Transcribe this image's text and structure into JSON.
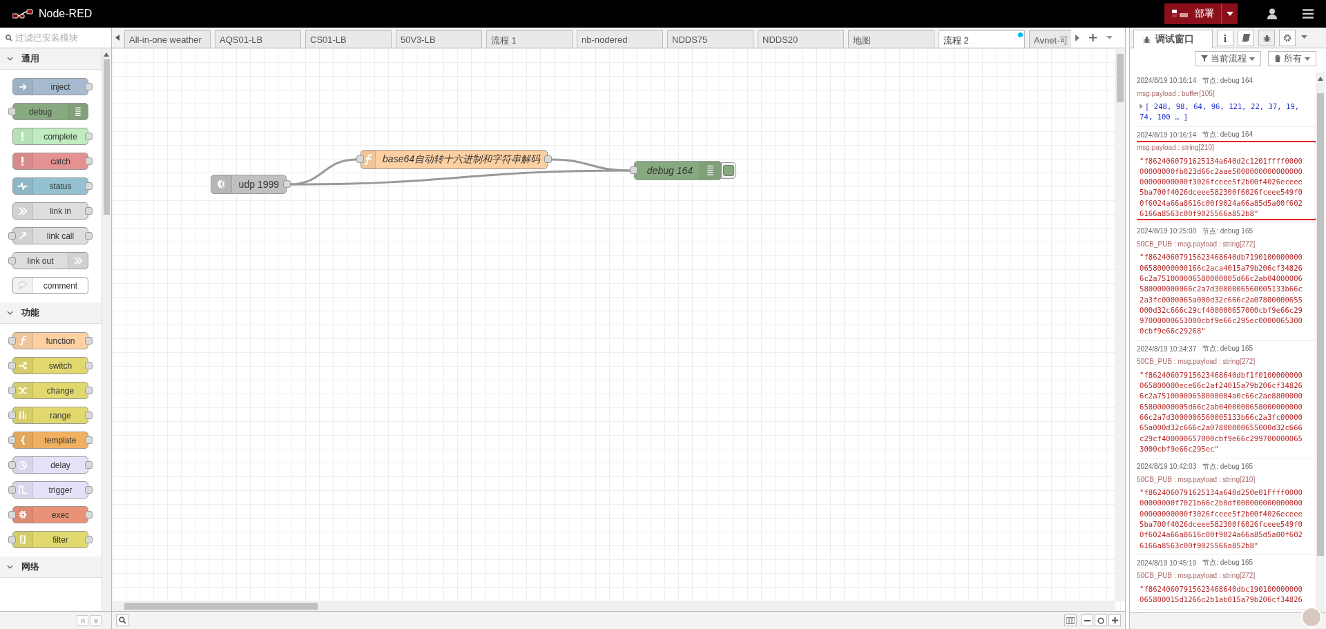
{
  "header": {
    "title": "Node-RED",
    "deploy": {
      "label": "部署"
    }
  },
  "palette": {
    "search": {
      "placeholder": "过滤已安装模块"
    },
    "categories": [
      {
        "label": "通用",
        "expanded": true,
        "nodes": [
          {
            "label": "inject",
            "color": "#a6bbcf",
            "input": false,
            "output": true,
            "icon_right": false
          },
          {
            "label": "debug",
            "color": "#87a980",
            "input": true,
            "output": false,
            "icon_right": true
          },
          {
            "label": "complete",
            "color": "#c0edc0",
            "input": false,
            "output": true,
            "icon_right": false
          },
          {
            "label": "catch",
            "color": "#e49191",
            "input": false,
            "output": true,
            "icon_right": false
          },
          {
            "label": "status",
            "color": "#94c1d0",
            "input": false,
            "output": true,
            "icon_right": false
          },
          {
            "label": "link in",
            "color": "#dddddd",
            "input": false,
            "output": true,
            "icon_right": false
          },
          {
            "label": "link call",
            "color": "#dddddd",
            "input": true,
            "output": true,
            "icon_right": false
          },
          {
            "label": "link out",
            "color": "#dddddd",
            "input": true,
            "output": false,
            "icon_right": true
          },
          {
            "label": "comment",
            "color": "#ffffff",
            "input": false,
            "output": false,
            "icon_right": false
          }
        ]
      },
      {
        "label": "功能",
        "expanded": true,
        "nodes": [
          {
            "label": "function",
            "color": "#fdd0a2",
            "input": true,
            "output": true,
            "icon_right": false
          },
          {
            "label": "switch",
            "color": "#e2d96e",
            "input": true,
            "output": true,
            "icon_right": false
          },
          {
            "label": "change",
            "color": "#e2d96e",
            "input": true,
            "output": true,
            "icon_right": false
          },
          {
            "label": "range",
            "color": "#e2d96e",
            "input": true,
            "output": true,
            "icon_right": false
          },
          {
            "label": "template",
            "color": "#f0b060",
            "input": true,
            "output": true,
            "icon_right": false
          },
          {
            "label": "delay",
            "color": "#e6e0f8",
            "input": true,
            "output": true,
            "icon_right": false
          },
          {
            "label": "trigger",
            "color": "#e6e0f8",
            "input": true,
            "output": true,
            "icon_right": false
          },
          {
            "label": "exec",
            "color": "#ea9277",
            "input": true,
            "output": true,
            "icon_right": false
          },
          {
            "label": "filter",
            "color": "#e2d96e",
            "input": true,
            "output": true,
            "icon_right": false
          }
        ]
      },
      {
        "label": "网络",
        "expanded": true
      }
    ]
  },
  "workspace": {
    "tabs": [
      {
        "label": "All-in-one weather",
        "selected": false,
        "changed": false
      },
      {
        "label": "AQS01-LB",
        "selected": false,
        "changed": false
      },
      {
        "label": "CS01-LB",
        "selected": false,
        "changed": false
      },
      {
        "label": "50V3-LB",
        "selected": false,
        "changed": false
      },
      {
        "label": "流程 1",
        "selected": false,
        "changed": false
      },
      {
        "label": "nb-nodered",
        "selected": false,
        "changed": false
      },
      {
        "label": "NDDS75",
        "selected": false,
        "changed": false
      },
      {
        "label": "NDDS20",
        "selected": false,
        "changed": false
      },
      {
        "label": "地图",
        "selected": false,
        "changed": false
      },
      {
        "label": "流程 2",
        "selected": true,
        "changed": true
      },
      {
        "label": "Avnet-可",
        "selected": false,
        "changed": false
      }
    ],
    "nodes": [
      {
        "label": "udp 1999",
        "color": "#c0c0c0",
        "input": false,
        "output": true,
        "icon_right": false,
        "italic": false
      },
      {
        "label": "base64自动转十六进制和字符串解码",
        "color": "#fdd0a2",
        "input": true,
        "output": true,
        "icon_right": false,
        "italic": true
      },
      {
        "label": "debug 164",
        "color": "#87a980",
        "input": true,
        "output": false,
        "icon_right": true,
        "italic": true,
        "active": true
      }
    ]
  },
  "sidebar": {
    "tabs": [
      {
        "label": "调试窗口",
        "selected": true
      }
    ],
    "filters": [
      {
        "label": "当前流程"
      },
      {
        "label": "所有"
      }
    ],
    "messages": [
      {
        "time": "2024/8/19 10:16:14",
        "node": "节点: debug 164",
        "meta": "msg.payload : buffer[105]",
        "kind": "array",
        "value": "[ 248, 98, 64, 96, 121, 22, 37, 19, 74, 100 … ]",
        "highlighted": false
      },
      {
        "time": "2024/8/19 10:16:14",
        "node": "节点: debug 164",
        "meta": "msg.payload : string[210]",
        "kind": "string",
        "value": "\"f8624060791625134a640d2c1201ffff000000000000fb023d66c2aae500000000000000000000000000f3026fceee5f2b00f4026eceee5ba700f4026dceee582300f6026fceee549f00f6024a66a8616c00f9024a66a85d5a00f6026166a8563c00f9025566a852b8\"",
        "highlighted": true
      },
      {
        "time": "2024/8/19 10:25:00",
        "node": "节点: debug 165",
        "meta": "50CB_PUB : msg.payload : string[272]",
        "kind": "string",
        "value": "\"f86240607915623468640db719010000000006580000000166c2aca4015a79b206cf348266c2a751000006580000005d66c2ab04000006580000000066c2a7d3000006560005133b66c2a3fc0000065a000d32c666c2a07800000655000d32c666c29cf400000657000cbf9e66c2997000000653000cbf9e66c295ec00000653000cbf9e66c29268\"",
        "highlighted": false
      },
      {
        "time": "2024/8/19 10:34:37",
        "node": "节点: debug 165",
        "meta": "50CB_PUB : msg.payload : string[272]",
        "kind": "string",
        "value": "\"f86240607915623468640dbf1f0100000000065800000ece66c2af24015a79b206cf348266c2a75100000658000004a0c66c2ae880000065800000005d66c2ab040000065800000000066c2a7d3000006560005133b66c2a3fc0000065a000d32c666c2a07800000655000d32c666c29cf400000657000cbf9e66c2997000000653000cbf9e66c295ec\"",
        "highlighted": false
      },
      {
        "time": "2024/8/19 10:42:03",
        "node": "节点: debug 165",
        "meta": "50CB_PUB : msg.payload : string[210]",
        "kind": "string",
        "value": "\"f8624060791625134a640d250e01Ffff000000000000f7021b66c2b0df00000000000000000000000000f3026fceee5f2b00f4026eceee5ba700f4026dceee582300f6026fceee549f00f6024a66a8616c00f9024a66a85d5a00f6026166a8563c00f9025566a852b8\"",
        "highlighted": false
      },
      {
        "time": "2024/8/19 10:45:19",
        "node": "节点: debug 165",
        "meta": "50CB_PUB : msg.payload : string[272]",
        "kind": "string",
        "value": "\"f86240607915623468640dbc190100000000065800015d1266c2b1ab015a79b206cf34826",
        "highlighted": false
      }
    ]
  }
}
